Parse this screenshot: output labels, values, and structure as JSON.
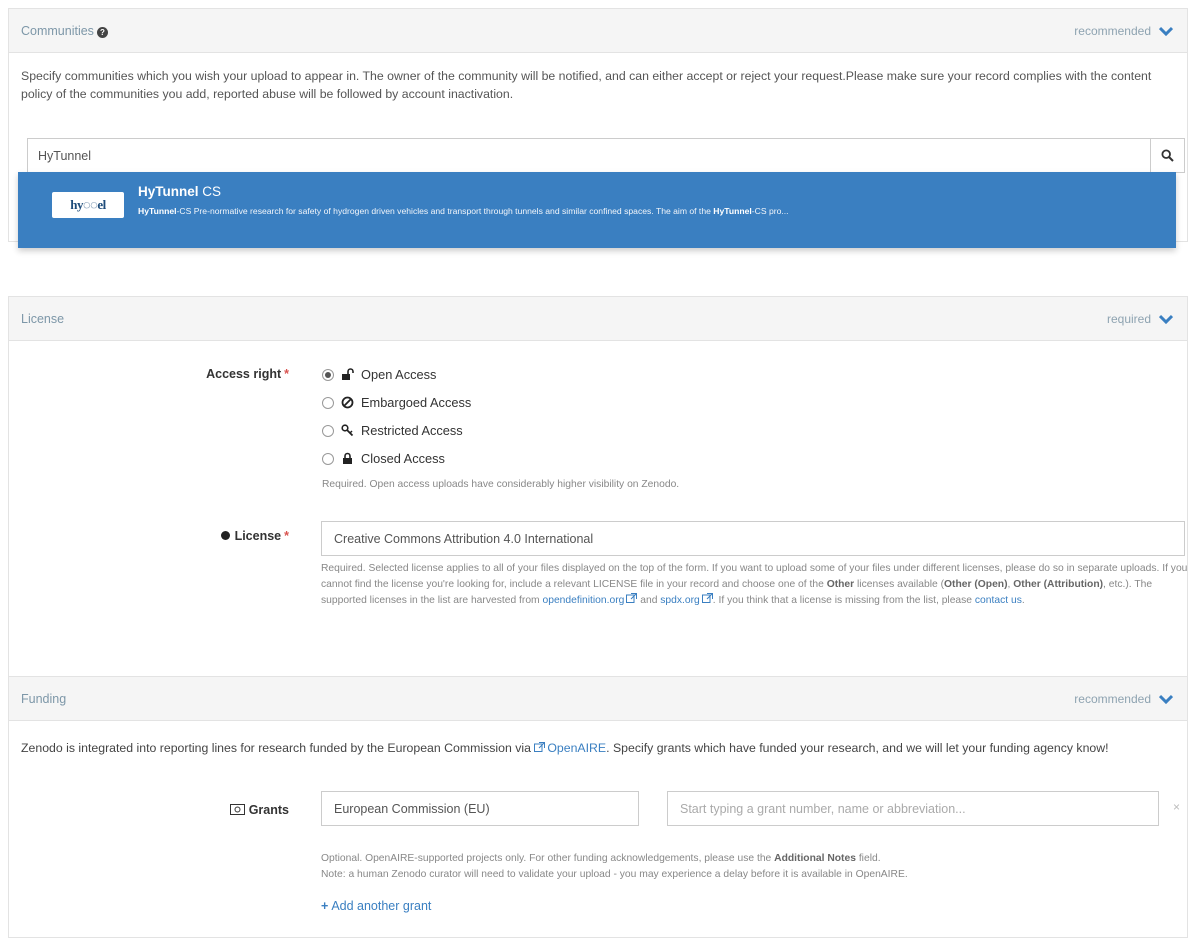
{
  "communities": {
    "title": "Communities",
    "status": "recommended",
    "description": "Specify communities which you wish your upload to appear in. The owner of the community will be notified, and can either accept or reject your request.Please make sure your record complies with the content policy of the communities you add, reported abuse will be followed by account inactivation.",
    "search_value": "HyTunnel",
    "result": {
      "logo_text": "hy◌◌el",
      "title_bold": "HyTunnel",
      "title_rest": " CS",
      "desc_bold1": "HyTunnel",
      "desc_mid": "-CS Pre-normative research for safety of hydrogen driven vehicles and transport through tunnels and similar confined spaces.   The aim of the ",
      "desc_bold2": "HyTunnel",
      "desc_end": "-CS pro..."
    }
  },
  "license": {
    "title": "License",
    "status": "required",
    "access_right_label": "Access right",
    "options": [
      {
        "label": "Open Access",
        "icon": "unlock-icon",
        "selected": true
      },
      {
        "label": "Embargoed Access",
        "icon": "ban-icon",
        "selected": false
      },
      {
        "label": "Restricted Access",
        "icon": "key-icon",
        "selected": false
      },
      {
        "label": "Closed Access",
        "icon": "lock-icon",
        "selected": false
      }
    ],
    "access_help": "Required. Open access uploads have considerably higher visibility on Zenodo.",
    "license_label": "License",
    "license_value": "Creative Commons Attribution 4.0 International",
    "help_1": "Required. Selected license applies to all of your files displayed on the top of the form. If you want to upload some of your files under different licenses, please do so in separate uploads. If you cannot find the license you're looking for, include a relevant LICENSE file in your record and choose one of the ",
    "help_other": "Other",
    "help_2": " licenses available (",
    "help_other_open": "Other (Open)",
    "help_3": ", ",
    "help_other_attr": "Other (Attribution)",
    "help_4": ", etc.). The supported licenses in the list are harvested from ",
    "link_opendefinition": "opendefinition.org",
    "help_5": " and ",
    "link_spdx": "spdx.org",
    "help_6": ". If you think that a license is missing from the list, please ",
    "link_contact": "contact us",
    "help_7": "."
  },
  "funding": {
    "title": "Funding",
    "status": "recommended",
    "desc_1": "Zenodo is integrated into reporting lines for research funded by the European Commission via ",
    "desc_link": "OpenAIRE",
    "desc_2": ". Specify grants which have funded your research, and we will let your funding agency know!",
    "grants_label": "Grants",
    "funder_value": "European Commission (EU)",
    "grant_placeholder": "Start typing a grant number, name or abbreviation...",
    "remove": "×",
    "help_1": "Optional. OpenAIRE-supported projects only. For other funding acknowledgements, please use the ",
    "help_bold": "Additional Notes",
    "help_2": " field.",
    "help_line2": "Note: a human Zenodo curator will need to validate your upload - you may experience a delay before it is available in OpenAIRE.",
    "add_grant": "Add another grant"
  },
  "colors": {
    "accent": "#3a7fc1",
    "panel_header": "#f5f5f5",
    "required": "#d9534f"
  }
}
